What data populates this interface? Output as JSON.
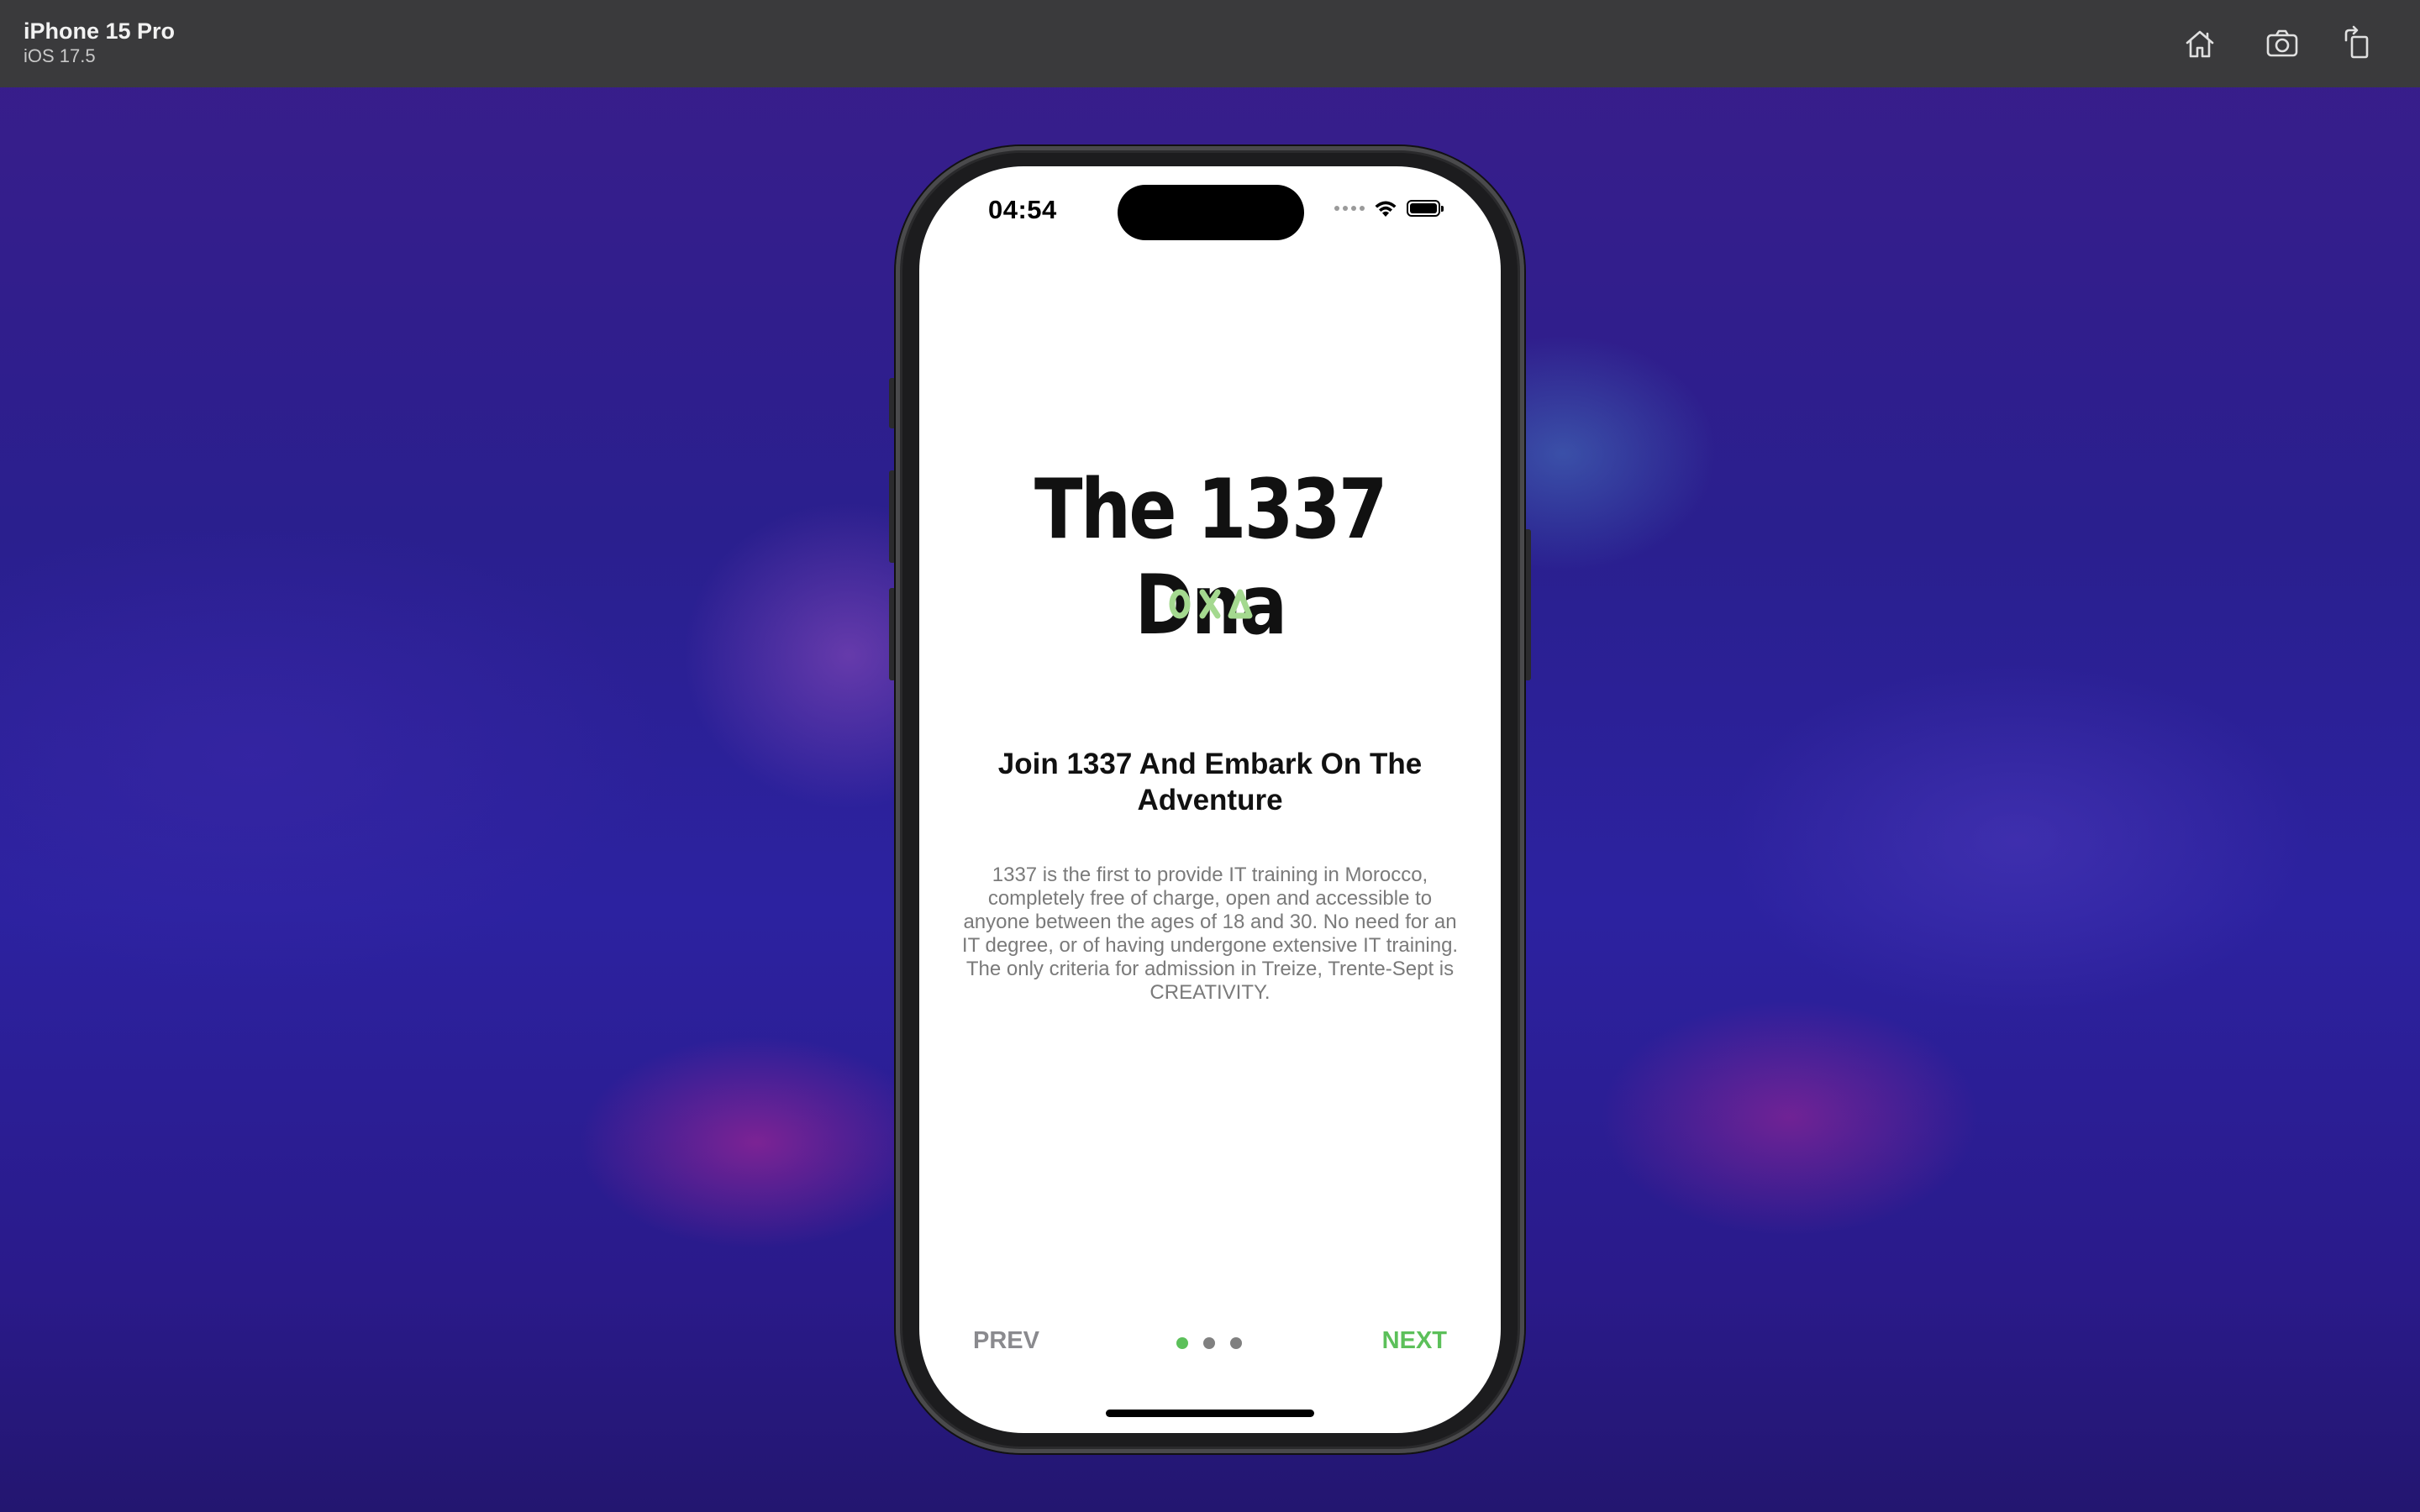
{
  "simulator": {
    "device_name": "iPhone 15 Pro",
    "os_version": "iOS 17.5",
    "toolbar": {
      "home_icon": "home-icon",
      "screenshot_icon": "camera-icon",
      "rotate_icon": "rotate-icon"
    }
  },
  "status_bar": {
    "time": "04:54",
    "icons": [
      "cellular-signal-icon",
      "wifi-icon",
      "battery-icon"
    ]
  },
  "onboarding": {
    "app_title": "The 1337 Dna",
    "logo_glyphs": [
      "circle-glyph",
      "cross-glyph",
      "triangle-glyph"
    ],
    "headline": "Join 1337 And Embark On The Adventure",
    "description": "1337 is the first to provide IT training in Morocco, completely free of charge, open and accessible to anyone between the ages of 18 and 30. No need for an IT degree, or of having undergone extensive IT training. The only criteria for admission in Treize, Trente-Sept is CREATIVITY.",
    "prev_label": "PREV",
    "next_label": "NEXT",
    "page_count": 3,
    "current_page": 1
  },
  "colors": {
    "accent_green": "#5cc05a",
    "logo_green": "#a4d98f",
    "inactive_gray": "#8a8a8e",
    "titlebar": "#3a3a3c"
  }
}
